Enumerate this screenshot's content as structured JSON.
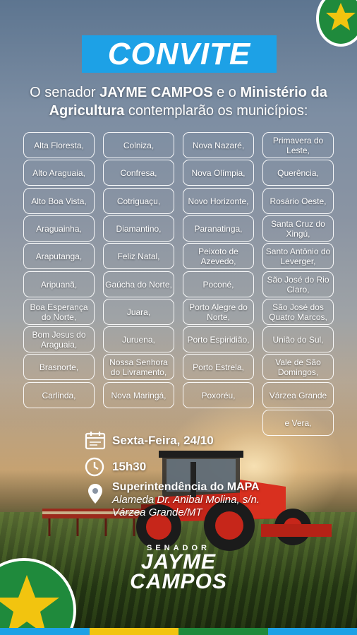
{
  "title": "CONVITE",
  "subtitle": {
    "part1": "O senador ",
    "name": "JAYME CAMPOS",
    "part2": " e o ",
    "ministry": "Ministério da Agricultura",
    "part3": " contemplarão os municípios:"
  },
  "municipalities": [
    [
      "Alta Floresta,",
      "Alto Araguaia,",
      "Alto Boa Vista,",
      "Araguainha,",
      "Araputanga,",
      "Aripuanã,",
      "Boa Esperança do Norte,",
      "Bom Jesus do Araguaia,",
      "Brasnorte,",
      "Carlinda,"
    ],
    [
      "Colniza,",
      "Confresa,",
      "Cotriguaçu,",
      "Diamantino,",
      "Feliz Natal,",
      "Gaúcha do Norte,",
      "Juara,",
      "Juruena,",
      "Nossa Senhora do Livramento,",
      "Nova Maringá,"
    ],
    [
      "Nova Nazaré,",
      "Nova Olímpia,",
      "Novo Horizonte,",
      "Paranatinga,",
      "Peixoto de Azevedo,",
      "Poconé,",
      "Porto Alegre do Norte,",
      "Porto Espiridião,",
      "Porto Estrela,",
      "Poxoréu,"
    ],
    [
      "Primavera do Leste,",
      "Querência,",
      "Rosário Oeste,",
      "Santa Cruz do Xingú,",
      "Santo Antônio do Leverger,",
      "São José do Rio Claro,",
      "São José dos Quatro Marcos,",
      "União do Sul,",
      "Vale de São Domingos,",
      "Várzea Grande",
      "e Vera,"
    ]
  ],
  "event": {
    "date": "Sexta-Feira, 24/10",
    "time": "15h30",
    "venue": "Superintendência do MAPA",
    "address_line1": "Alameda Dr. Anibal Molina, s/n.",
    "address_line2": "Várzea Grande/MT"
  },
  "brand": {
    "small": "SENADOR",
    "line1": "JAYME",
    "line2": "CAMPOS"
  },
  "colors": {
    "title_bg": "#1da1e6",
    "green": "#1f8a3c",
    "yellow": "#f2c40f",
    "blue": "#1da1e6"
  },
  "icons": [
    "calendar-icon",
    "clock-icon",
    "location-pin-icon",
    "star-icon"
  ]
}
